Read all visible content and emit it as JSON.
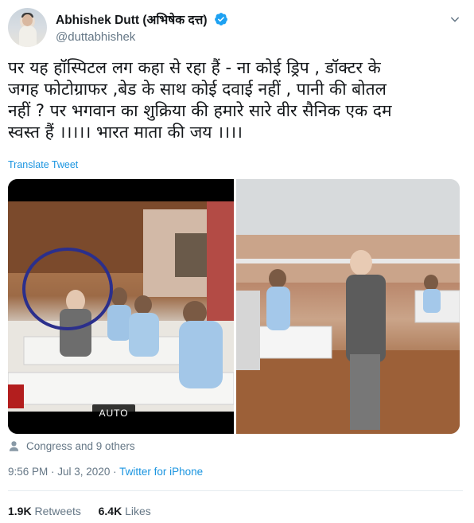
{
  "author": {
    "display_name": "Abhishek Dutt (अभिषेक दत्त)",
    "handle": "@duttabhishek",
    "verified": true
  },
  "tweet": {
    "text": "पर यह हॉस्पिटल लग कहा से रहा हैं - ना कोई ड्रिप , डॉक्टर के\nजगह फोटोग्राफर ,बेड के साथ कोई दवाई नहीं , पानी की बोतल\nनहीं ? पर भगवान का शुक्रिया की हमारे सारे वीर सैनिक एक दम\nस्वस्त हैं ।।।।। भारत माता की जय ।।।।",
    "translate_label": "Translate Tweet"
  },
  "media": {
    "video_badge": "AUTO"
  },
  "liked_by": "Congress and 9 others",
  "meta": {
    "time": "9:56 PM",
    "separator": " · ",
    "date": "Jul 3, 2020",
    "source": "Twitter for iPhone"
  },
  "stats": {
    "retweets_count": "1.9K",
    "retweets_label": "Retweets",
    "likes_count": "6.4K",
    "likes_label": "Likes"
  },
  "colors": {
    "link": "#1b95e0",
    "secondary_text": "#657786",
    "verified_badge": "#1da1f2"
  },
  "icons": {
    "verified": "verified-badge-icon",
    "caret": "chevron-down-icon",
    "liked_by": "person-icon"
  }
}
